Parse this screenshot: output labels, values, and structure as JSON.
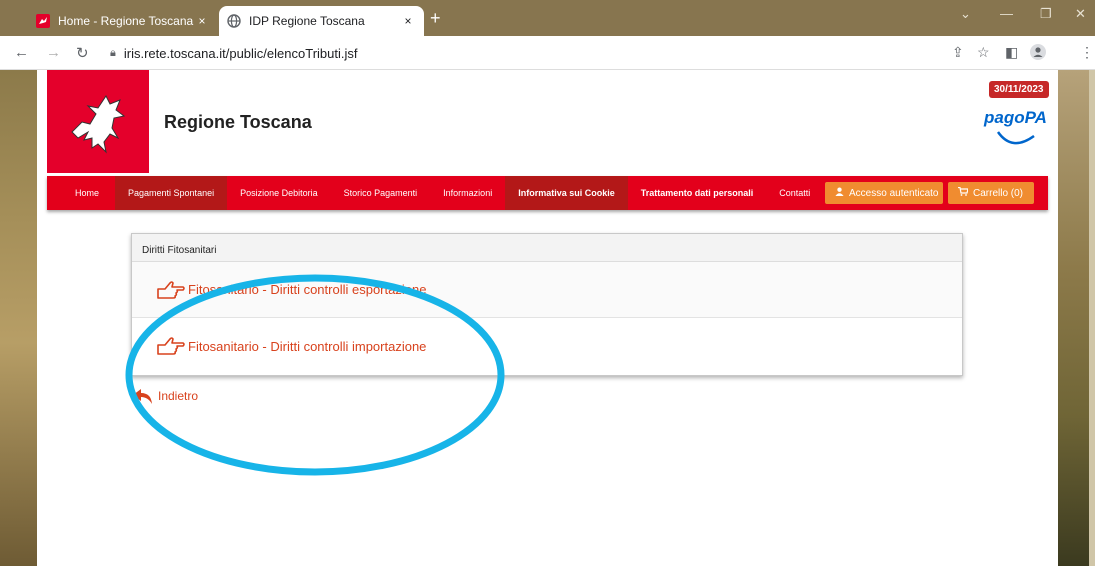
{
  "browser": {
    "tabs": [
      {
        "title": "Home - Regione Toscana",
        "close": "×",
        "active": false
      },
      {
        "title": "IDP Regione Toscana",
        "close": "×",
        "active": true
      }
    ],
    "new_tab": "+",
    "url": "iris.rete.toscana.it/public/elencoTributi.jsf"
  },
  "header": {
    "site_title": "Regione Toscana",
    "date": "30/11/2023",
    "pagopa": "pagoPA"
  },
  "menu": {
    "items": [
      "Home",
      "Pagamenti Spontanei",
      "Posizione Debitoria",
      "Storico Pagamenti",
      "Informazioni",
      "Informativa sui Cookie",
      "Trattamento dati personali",
      "Contatti"
    ],
    "login": "Accesso autenticato",
    "cart": "Carrello (0)"
  },
  "panel": {
    "title": "Diritti Fitosanitari",
    "items": [
      "Fitosanitario - Diritti controlli esportazione",
      "Fitosanitario - Diritti controlli importazione"
    ]
  },
  "back_label": "Indietro",
  "colors": {
    "brand_red": "#e3001b",
    "link_orange": "#d8421d",
    "button_orange": "#f08c30",
    "annotation_cyan": "#17b4e8"
  }
}
